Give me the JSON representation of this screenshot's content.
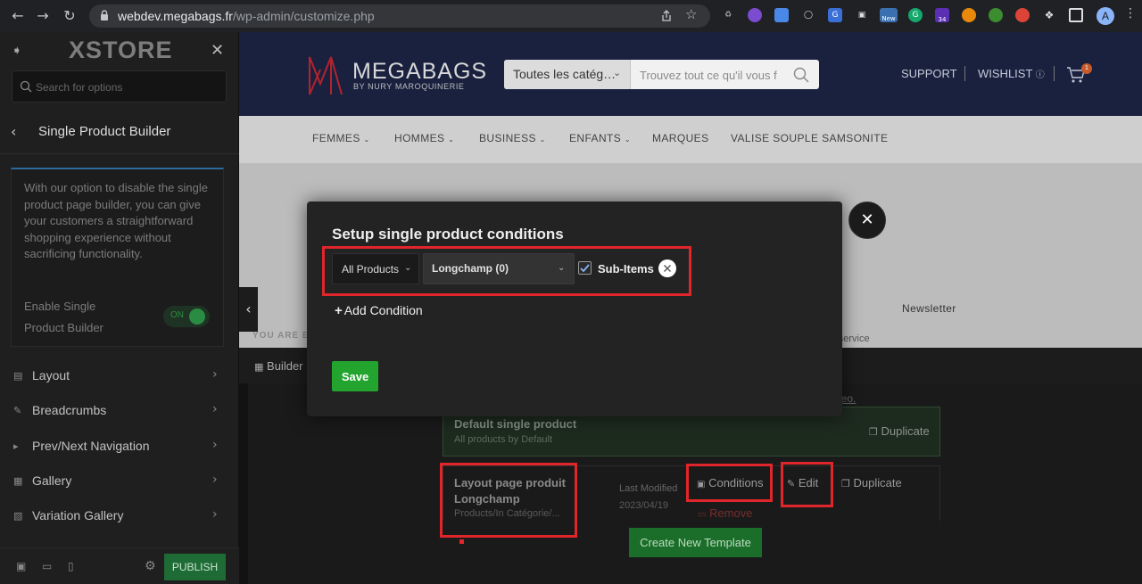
{
  "browser": {
    "url_host": "webdev.megabags.fr",
    "url_path": "/wp-admin/customize.php",
    "ext_badge_new": "New",
    "ext_badge_count": "34",
    "avatar_letter": "A"
  },
  "sidebar": {
    "logo": "XSTORE",
    "search_placeholder": "Search for options",
    "section_title": "Single Product Builder",
    "info_text": "With our option to disable the single product page builder, you can give your customers a straightforward shopping experience without sacrificing functionality.",
    "enable_label": "Enable Single Product Builder",
    "toggle_label": "ON",
    "items": [
      {
        "label": "Layout"
      },
      {
        "label": "Breadcrumbs"
      },
      {
        "label": "Prev/Next Navigation"
      },
      {
        "label": "Gallery"
      },
      {
        "label": "Variation Gallery"
      }
    ],
    "publish_label": "PUBLISH"
  },
  "site": {
    "brand_name": "MEGABAGS",
    "brand_sub": "BY NURY MAROQUINERIE",
    "category_select": "Toutes les catég…",
    "search_placeholder": "Trouvez tout ce qu'il vous f",
    "support": "SUPPORT",
    "wishlist": "WISHLIST",
    "cart_count": "1",
    "nav": [
      "FEMMES",
      "HOMMES",
      "BUSINESS",
      "ENFANTS",
      "MARQUES",
      "VALISE SOUPLE SAMSONITE"
    ],
    "newsletter": "Newsletter",
    "service": "r service",
    "you_are": "YOU ARE EI",
    "builder_tab": "Builder",
    "video_link": "leo."
  },
  "templates": {
    "default": {
      "title": "Default single product",
      "subtitle": "All products by Default",
      "duplicate": "Duplicate"
    },
    "layout": {
      "title": "Layout page produit Longchamp",
      "subtitle": "Products/In Catégorie/...",
      "last_modified_label": "Last Modified",
      "last_modified_date": "2023/04/19",
      "conditions": "Conditions",
      "remove": "Remove",
      "edit": "Edit",
      "duplicate": "Duplicate"
    },
    "create_new": "Create New Template"
  },
  "modal": {
    "title": "Setup single product conditions",
    "products_select": "All Products",
    "category_select": "Longchamp (0)",
    "subitems_label": "Sub-Items",
    "subitems_checked": true,
    "add_condition": "Add Condition",
    "save": "Save"
  },
  "colors": {
    "accent_green": "#22a42f",
    "annotation_red": "#e0262b",
    "site_header": "#19213f"
  }
}
